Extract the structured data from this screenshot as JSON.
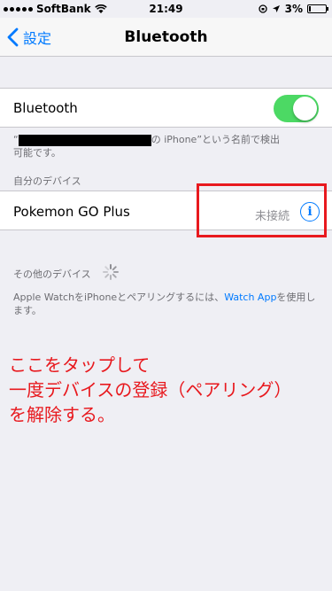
{
  "status_bar": {
    "carrier": "SoftBank",
    "time": "21:49",
    "battery": "3%",
    "battery_level": 0.03
  },
  "nav": {
    "back_label": "設定",
    "title": "Bluetooth"
  },
  "bluetooth_toggle": {
    "label": "Bluetooth",
    "state": "on",
    "color": "#4cd964"
  },
  "discoverable_note": {
    "quote_open": "“",
    "text_after_redaction": "の iPhone”という名前で検出",
    "line2": "可能です。"
  },
  "my_devices": {
    "header": "自分のデバイス",
    "items": [
      {
        "name": "Pokemon GO Plus",
        "status": "未接続",
        "icon": "info-icon"
      }
    ]
  },
  "other_devices": {
    "header": "その他のデバイス"
  },
  "apple_watch_note": {
    "prefix": "Apple WatchをiPhoneとペアリングするには、",
    "link": "Watch App",
    "suffix": "を使用します。"
  },
  "annotation": {
    "lines": [
      "ここをタップして",
      "一度デバイスの登録（ペアリング）",
      "を解除する。"
    ],
    "color": "#e8191e"
  }
}
